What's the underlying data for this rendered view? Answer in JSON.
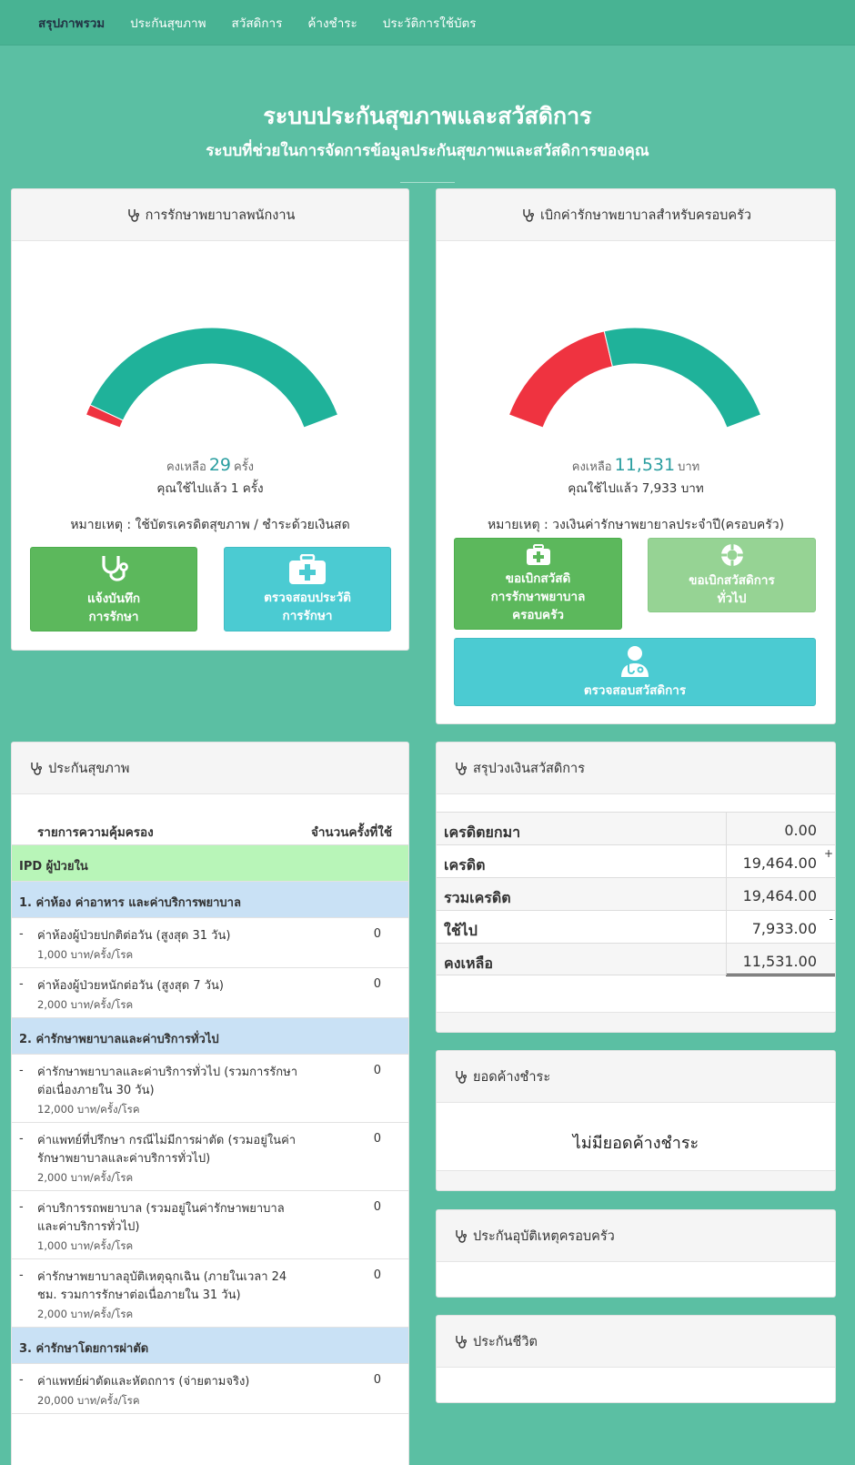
{
  "nav": {
    "items": [
      "สรุปภาพรวม",
      "ประกันสุขภาพ",
      "สวัสดิการ",
      "ค้างชำระ",
      "ประวัติการใช้บัตร"
    ]
  },
  "hero": {
    "title": "ระบบประกันสุขภาพและสวัสดิการ",
    "subtitle": "ระบบที่ช่วยในการจัดการข้อมูลประกันสุขภาพและสวัสดิการของคุณ"
  },
  "employee_panel": {
    "title": "การรักษาพยาบาลพนักงาน",
    "gauge": {
      "used_fraction": 0.033,
      "used_color": "#ef3340",
      "remain_color": "#1fb29a"
    },
    "remain_prefix": "คงเหลือ",
    "remain_value": "29",
    "remain_unit": "ครั้ง",
    "used_text": "คุณใช้ไปแล้ว 1 ครั้ง",
    "note": "หมายเหตุ : ใช้บัตรเครดิตสุขภาพ / ชำระด้วยเงินสด",
    "btn_record_l1": "แจ้งบันทึก",
    "btn_record_l2": "การรักษา",
    "btn_history_l1": "ตรวจสอบประวัติ",
    "btn_history_l2": "การรักษา"
  },
  "family_panel": {
    "title": "เบิกค่ารักษาพยาบาลสำหรับครอบครัว",
    "gauge": {
      "used_fraction": 0.405,
      "used_color": "#ef3340",
      "remain_color": "#1fb29a"
    },
    "remain_prefix": "คงเหลือ",
    "remain_value": "11,531",
    "remain_unit": "บาท",
    "used_text": "คุณใช้ไปแล้ว 7,933 บาท",
    "note": "หมายเหตุ : วงเงินค่ารักษาพยายาลประจำปี(ครอบครัว)",
    "btn_claim_l1": "ขอเบิกสวัสดิ",
    "btn_claim_l2": "การรักษาพยาบาล",
    "btn_claim_l3": "ครอบครัว",
    "btn_general_l1": "ขอเบิกสวัสดิการ",
    "btn_general_l2": "ทั่วไป",
    "btn_check": "ตรวจสอบสวัสดิการ"
  },
  "health_panel": {
    "title": "ประกันสุขภาพ",
    "col_coverage": "รายการความคุ้มครอง",
    "col_count": "จำนวนครั้งที่ใช้",
    "ipd": "IPD ผู้ป่วยใน",
    "sections": [
      {
        "title": "1. ค่าห้อง ค่าอาหาร และค่าบริการพยาบาล"
      },
      {
        "title": "2. ค่ารักษาพยาบาลและค่าบริการทั่วไป"
      },
      {
        "title": "3. ค่ารักษาโดยการผ่าตัด"
      }
    ],
    "items": [
      {
        "dash": "-",
        "name": "ค่าห้องผู้ป่วยปกติต่อวัน (สูงสุด 31 วัน)",
        "limit": "1,000 บาท/ครั้ง/โรค",
        "count": "0"
      },
      {
        "dash": "-",
        "name": "ค่าห้องผู้ป่วยหนักต่อวัน (สูงสุด 7 วัน)",
        "limit": "2,000 บาท/ครั้ง/โรค",
        "count": "0"
      },
      {
        "dash": "-",
        "name": "ค่ารักษาพยาบาลและค่าบริการทั่วไป (รวมการรักษาต่อเนื่องภายใน 30 วัน)",
        "limit": "12,000 บาท/ครั้ง/โรค",
        "count": "0"
      },
      {
        "dash": "-",
        "name": "ค่าแพทย์ที่ปรึกษา กรณีไม่มีการผ่าตัด (รวมอยู่ในค่ารักษาพยาบาลและค่าบริการทั่วไป)",
        "limit": "2,000 บาท/ครั้ง/โรค",
        "count": "0"
      },
      {
        "dash": "-",
        "name": "ค่าบริการรถพยาบาล (รวมอยู่ในค่ารักษาพยาบาลและค่าบริการทั่วไป)",
        "limit": "1,000 บาท/ครั้ง/โรค",
        "count": "0"
      },
      {
        "dash": "-",
        "name": "ค่ารักษาพยาบาลอุบัติเหตุฉุกเฉิน (ภายในเวลา 24 ชม. รวมการรักษาต่อเนื่อภายใน 31 วัน)",
        "limit": "2,000 บาท/ครั้ง/โรค",
        "count": "0"
      },
      {
        "dash": "-",
        "name": "ค่าแพทย์ผ่าตัดและหัตถการ (จ่ายตามจริง)",
        "limit": "20,000 บาท/ครั้ง/โรค",
        "count": "0"
      }
    ]
  },
  "welfare_summary": {
    "title": "สรุปวงเงินสวัสดิการ",
    "rows": [
      {
        "label": "เครดิตยกมา",
        "value": "0.00",
        "sign": ""
      },
      {
        "label": "เครดิต",
        "value": "19,464.00",
        "sign": "+"
      },
      {
        "label": "รวมเครดิต",
        "value": "19,464.00",
        "sign": ""
      },
      {
        "label": "ใช้ไป",
        "value": "7,933.00",
        "sign": "-"
      },
      {
        "label": "คงเหลือ",
        "value": "11,531.00",
        "sign": ""
      }
    ]
  },
  "outstanding": {
    "title": "ยอดค้างชำระ",
    "message": "ไม่มียอดค้างชำระ"
  },
  "family_accident": {
    "title": "ประกันอุบัติเหตุครอบครัว"
  },
  "life_insurance": {
    "title": "ประกันชีวิต"
  }
}
